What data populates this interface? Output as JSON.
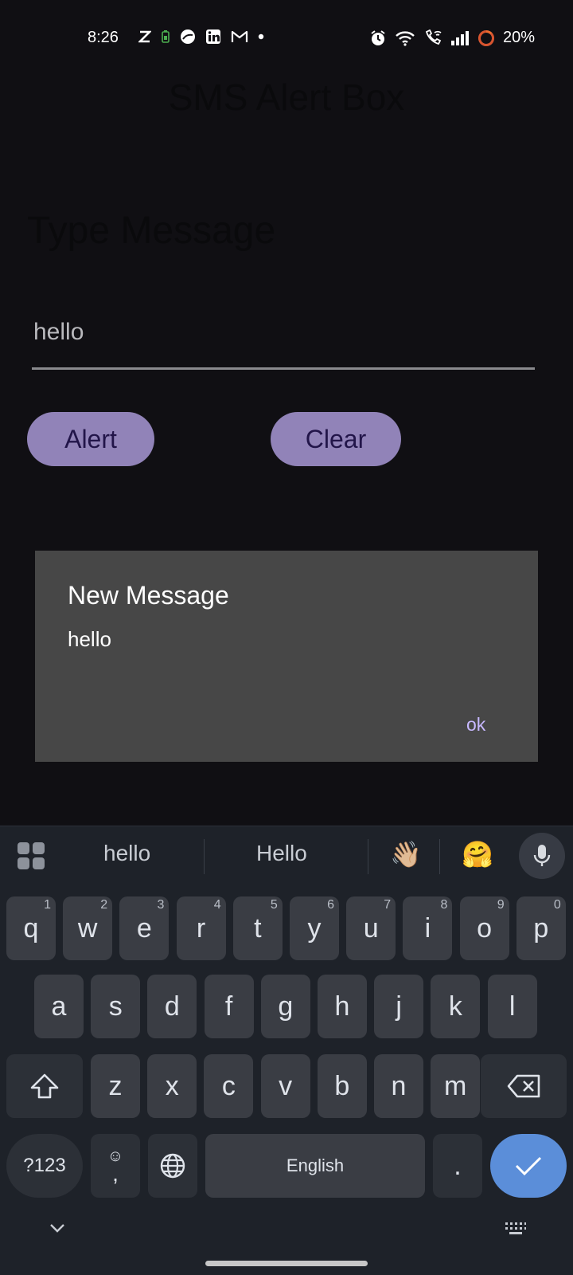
{
  "status_bar": {
    "time": "8:26",
    "left_icons": [
      "z-app-icon",
      "battery-saver-icon",
      "weather-icon",
      "linkedin-icon",
      "gmail-icon",
      "dot-icon"
    ],
    "right_icons": [
      "alarm-icon",
      "wifi-icon",
      "wifi-calling-icon",
      "signal-icon",
      "battery-ring-icon"
    ],
    "battery": "20%"
  },
  "app": {
    "title": "SMS Alert Box",
    "type_label": "Type Message",
    "message_value": "hello",
    "alert_button": "Alert",
    "clear_button": "Clear"
  },
  "dialog": {
    "title": "New Message",
    "message": "hello",
    "ok": "ok"
  },
  "keyboard": {
    "suggestions": [
      "hello",
      "Hello"
    ],
    "emoji_suggestions": [
      "👋🏼",
      "🤗"
    ],
    "row1": [
      "q",
      "w",
      "e",
      "r",
      "t",
      "y",
      "u",
      "i",
      "o",
      "p"
    ],
    "row1_hints": [
      "1",
      "2",
      "3",
      "4",
      "5",
      "6",
      "7",
      "8",
      "9",
      "0"
    ],
    "row2": [
      "a",
      "s",
      "d",
      "f",
      "g",
      "h",
      "j",
      "k",
      "l"
    ],
    "row3": [
      "z",
      "x",
      "c",
      "v",
      "b",
      "n",
      "m"
    ],
    "symbols_key": "?123",
    "comma_key": ",",
    "comma_emoji": "☺",
    "space_label": "English",
    "period_key": ".",
    "accent_color": "#5b8ed9"
  }
}
